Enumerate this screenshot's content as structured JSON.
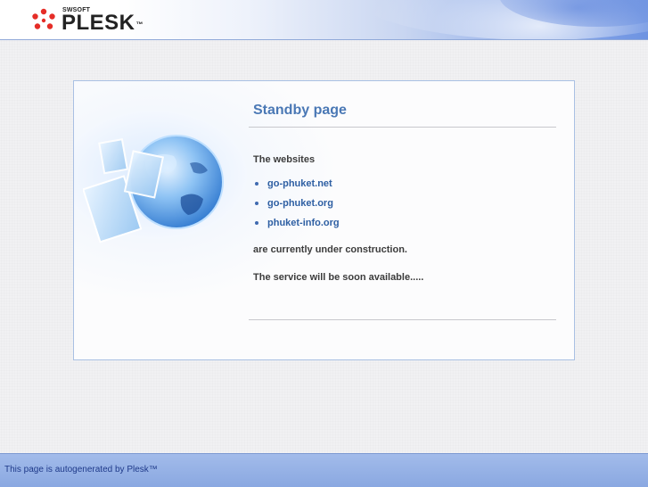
{
  "header": {
    "brand_small": "SWSOFT",
    "brand": "PLESK",
    "trademark": "™"
  },
  "card": {
    "title": "Standby page",
    "intro": "The websites",
    "sites": [
      {
        "label": "go-phuket.net"
      },
      {
        "label": "go-phuket.org"
      },
      {
        "label": "phuket-info.org"
      }
    ],
    "status": "are currently under construction.",
    "notice": "The service will be soon available....."
  },
  "footer": {
    "text": "This page is autogenerated by Plesk™"
  },
  "colors": {
    "title": "#4a78b5",
    "link": "#2e5fa3",
    "card_border": "#a9c0e3",
    "footer_bg": "#8aa8e1"
  }
}
